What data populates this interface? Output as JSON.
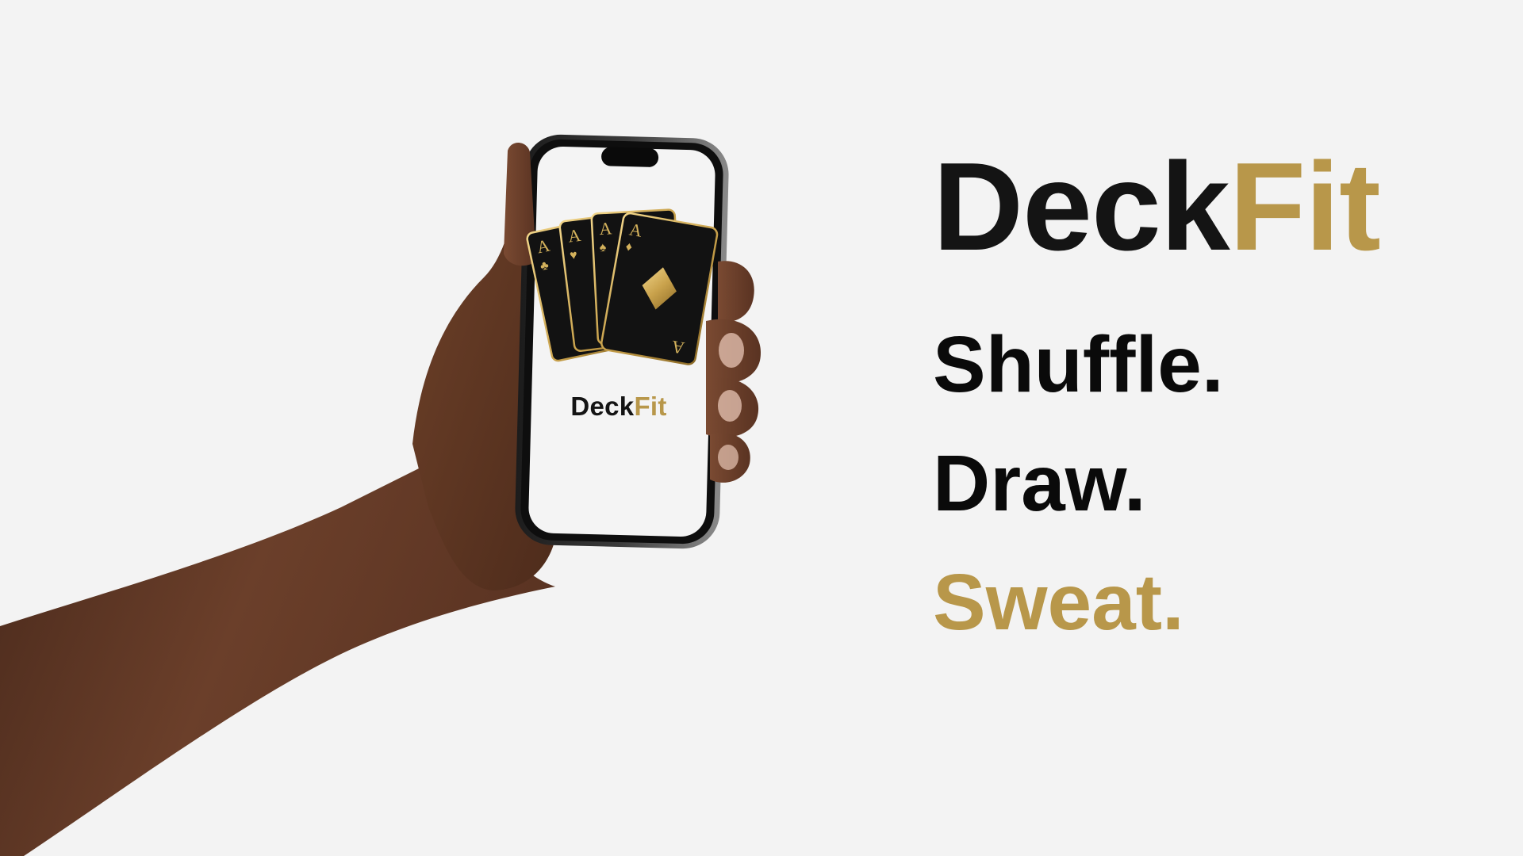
{
  "colors": {
    "background": "#f3f3f3",
    "dark": "#141414",
    "gold": "#b8974a",
    "phone_screen": "#f4f4f4",
    "card": "#121212",
    "skin": "#7a4a32"
  },
  "brand": {
    "part1": "Deck",
    "part2": "Fit"
  },
  "phone": {
    "app_name_part1": "Deck",
    "app_name_part2": "Fit",
    "cards": [
      {
        "rank": "A",
        "suit": "club-icon"
      },
      {
        "rank": "A",
        "suit": "heart-icon"
      },
      {
        "rank": "A",
        "suit": "spade-icon"
      },
      {
        "rank": "A",
        "suit": "diamond-icon"
      }
    ]
  },
  "taglines": {
    "line1": "Shuffle.",
    "line2": "Draw.",
    "line3": "Sweat."
  }
}
